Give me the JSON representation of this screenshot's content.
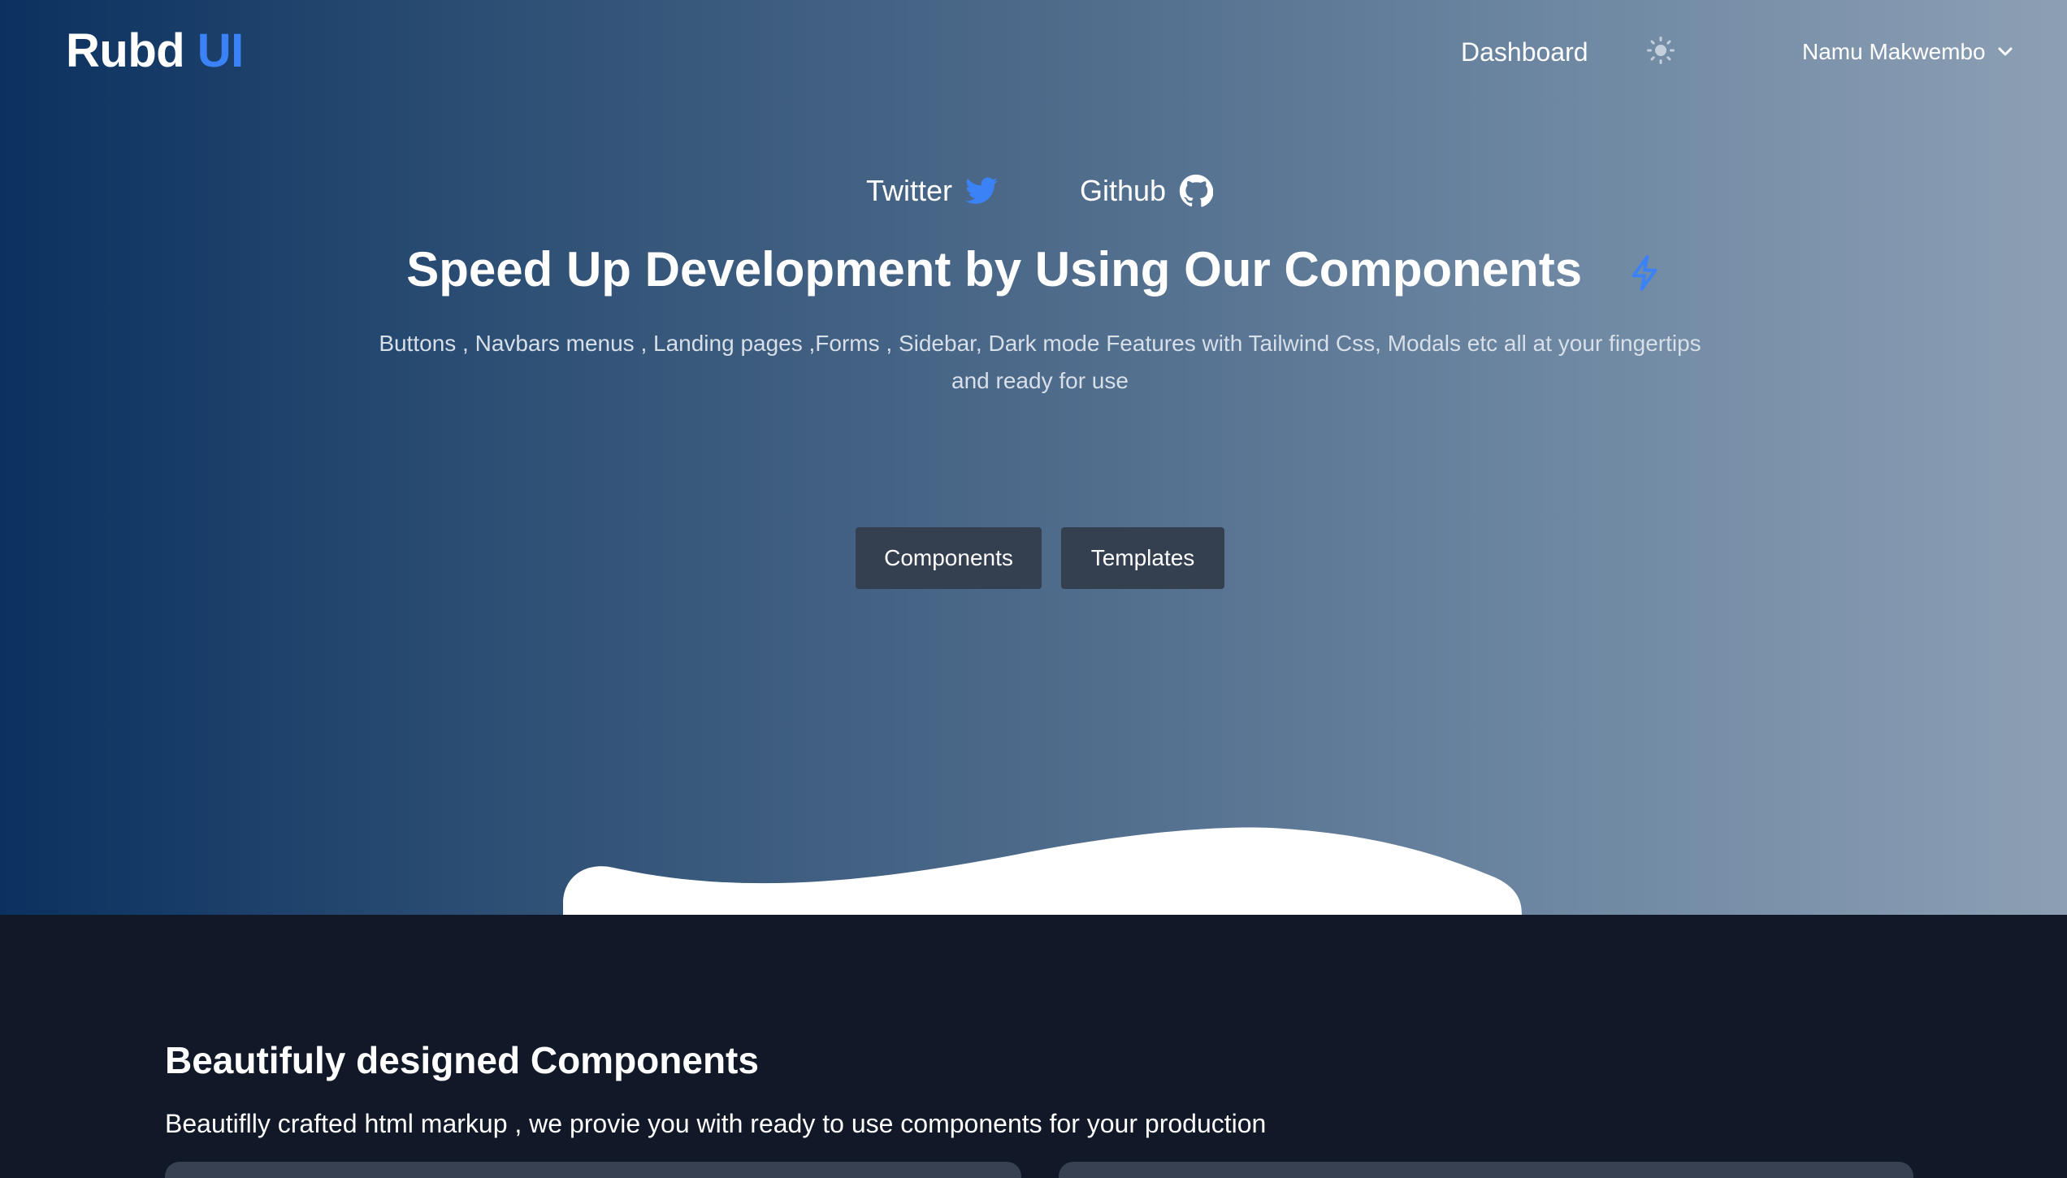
{
  "header": {
    "logo_main": "Rubd",
    "logo_accent": "UI",
    "nav_dashboard": "Dashboard",
    "user_name": "Namu Makwembo"
  },
  "hero": {
    "social": {
      "twitter_label": "Twitter",
      "github_label": "Github"
    },
    "headline": "Speed Up Development by Using Our Components",
    "subtitle_line1": "Buttons , Navbars menus , Landing pages ,Forms , Sidebar, Dark mode Features with Tailwind Css, Modals etc all at your fingertips",
    "subtitle_line2": "and ready for use",
    "buttons": {
      "components": "Components",
      "templates": "Templates"
    }
  },
  "section": {
    "title": "Beautifuly designed Components",
    "subtitle": "Beautiflly crafted html markup , we provie you with ready to use components for your production"
  },
  "colors": {
    "accent": "#3b82f6",
    "dark_background": "#111827",
    "button_background": "#343f50",
    "twitter_blue": "#3b82f6"
  },
  "icons": [
    "sun-icon",
    "chevron-down-icon",
    "twitter-icon",
    "github-icon",
    "bolt-icon"
  ]
}
